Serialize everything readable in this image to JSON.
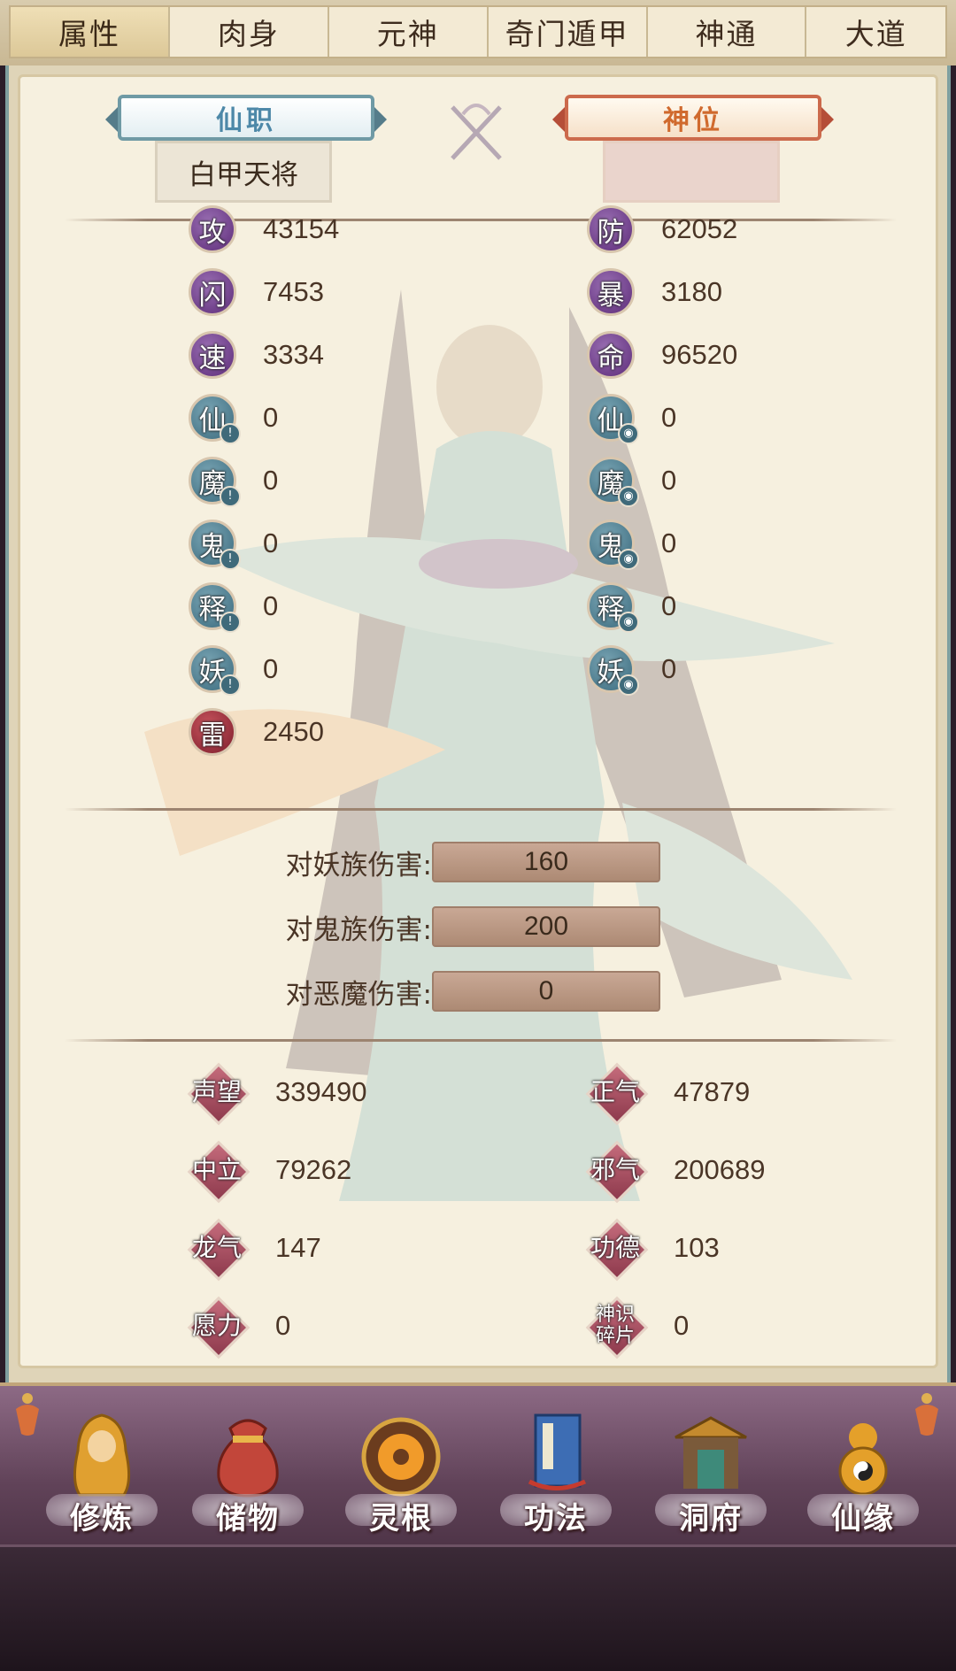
{
  "tabs": [
    "属性",
    "肉身",
    "元神",
    "奇门遁甲",
    "神通",
    "大道"
  ],
  "active_tab": "属性",
  "titles": {
    "left_badge": "仙职",
    "left_value": "白甲天将",
    "right_badge": "神位",
    "right_value": ""
  },
  "stats_left": [
    {
      "label": "攻",
      "value": "43154",
      "icon": "attack-icon"
    },
    {
      "label": "闪",
      "value": "7453",
      "icon": "dodge-icon"
    },
    {
      "label": "速",
      "value": "3334",
      "icon": "speed-icon"
    },
    {
      "label": "仙",
      "value": "0",
      "icon": "immortal-atk-icon"
    },
    {
      "label": "魔",
      "value": "0",
      "icon": "demon-atk-icon"
    },
    {
      "label": "鬼",
      "value": "0",
      "icon": "ghost-atk-icon"
    },
    {
      "label": "释",
      "value": "0",
      "icon": "buddha-atk-icon"
    },
    {
      "label": "妖",
      "value": "0",
      "icon": "monster-atk-icon"
    },
    {
      "label": "雷",
      "value": "2450",
      "icon": "thunder-icon"
    }
  ],
  "stats_right": [
    {
      "label": "防",
      "value": "62052",
      "icon": "defense-icon"
    },
    {
      "label": "暴",
      "value": "3180",
      "icon": "crit-icon"
    },
    {
      "label": "命",
      "value": "96520",
      "icon": "hp-icon"
    },
    {
      "label": "仙",
      "value": "0",
      "icon": "immortal-def-icon"
    },
    {
      "label": "魔",
      "value": "0",
      "icon": "demon-def-icon"
    },
    {
      "label": "鬼",
      "value": "0",
      "icon": "ghost-def-icon"
    },
    {
      "label": "释",
      "value": "0",
      "icon": "buddha-def-icon"
    },
    {
      "label": "妖",
      "value": "0",
      "icon": "monster-def-icon"
    }
  ],
  "damage": [
    {
      "label": "对妖族伤害:",
      "value": "160"
    },
    {
      "label": "对鬼族伤害:",
      "value": "200"
    },
    {
      "label": "对恶魔伤害:",
      "value": "0"
    }
  ],
  "reputation_left": [
    {
      "label": "声望",
      "value": "339490"
    },
    {
      "label": "中立",
      "value": "79262"
    },
    {
      "label": "龙气",
      "value": "147"
    },
    {
      "label": "愿力",
      "value": "0"
    }
  ],
  "reputation_right": [
    {
      "label": "正气",
      "value": "47879"
    },
    {
      "label": "邪气",
      "value": "200689"
    },
    {
      "label": "功德",
      "value": "103"
    },
    {
      "label": "神识碎片",
      "value": "0"
    }
  ],
  "bottom_nav": [
    {
      "label": "修炼",
      "icon": "cultivation-monk-icon"
    },
    {
      "label": "储物",
      "icon": "storage-bag-icon"
    },
    {
      "label": "灵根",
      "icon": "spirit-root-icon"
    },
    {
      "label": "功法",
      "icon": "technique-book-icon"
    },
    {
      "label": "洞府",
      "icon": "cave-mansion-icon"
    },
    {
      "label": "仙缘",
      "icon": "immortal-gourd-icon"
    }
  ],
  "colors": {
    "panel_bg": "#f6f0df",
    "stat_purple": "#5d2c79",
    "stat_teal": "#3b6a7d",
    "stat_red": "#7d1e2c",
    "rep_diamond": "#8e3a4d",
    "bottom_bar": "#614359"
  }
}
